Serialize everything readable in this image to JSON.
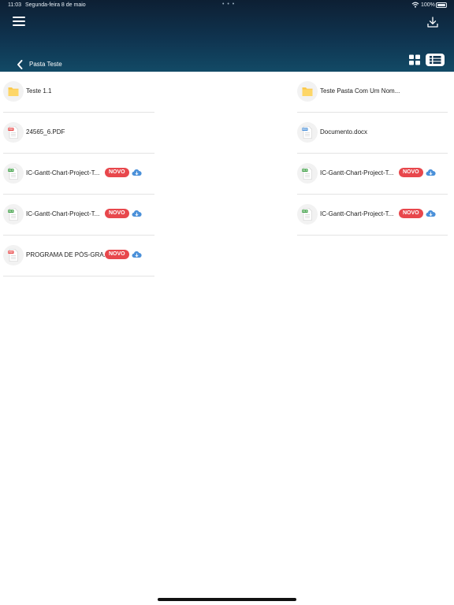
{
  "status": {
    "time": "11:03",
    "date": "Segunda-feira 8 de maio",
    "battery": "100%"
  },
  "breadcrumb": "Pasta Teste",
  "badge_label": "NOVO",
  "type_labels": {
    "pdf": "PDF",
    "xls": "XLS",
    "doc": "DOC"
  },
  "colors": {
    "header_top": "#0d1f33",
    "header_bottom": "#124a66",
    "badge": "#e8474c",
    "cloud": "#4a90d9",
    "folder": "#fbc94c",
    "pdf": "#e84545",
    "xls": "#3fa046",
    "doc": "#4a90d9"
  },
  "files": [
    {
      "name": "Teste 1.1",
      "type": "folder",
      "new": false
    },
    {
      "name": "Teste Pasta Com Um Nom...",
      "type": "folder",
      "new": false
    },
    {
      "name": "24565_6.PDF",
      "type": "pdf",
      "new": false
    },
    {
      "name": "Documento.docx",
      "type": "doc",
      "new": false
    },
    {
      "name": "IC-Gantt-Chart-Project-T...",
      "type": "xls",
      "new": true
    },
    {
      "name": "IC-Gantt-Chart-Project-T...",
      "type": "xls",
      "new": true
    },
    {
      "name": "IC-Gantt-Chart-Project-T...",
      "type": "xls",
      "new": true
    },
    {
      "name": "IC-Gantt-Chart-Project-T...",
      "type": "xls",
      "new": true
    },
    {
      "name": "PROGRAMA DE PÓS-GRA...",
      "type": "pdf",
      "new": true
    }
  ]
}
